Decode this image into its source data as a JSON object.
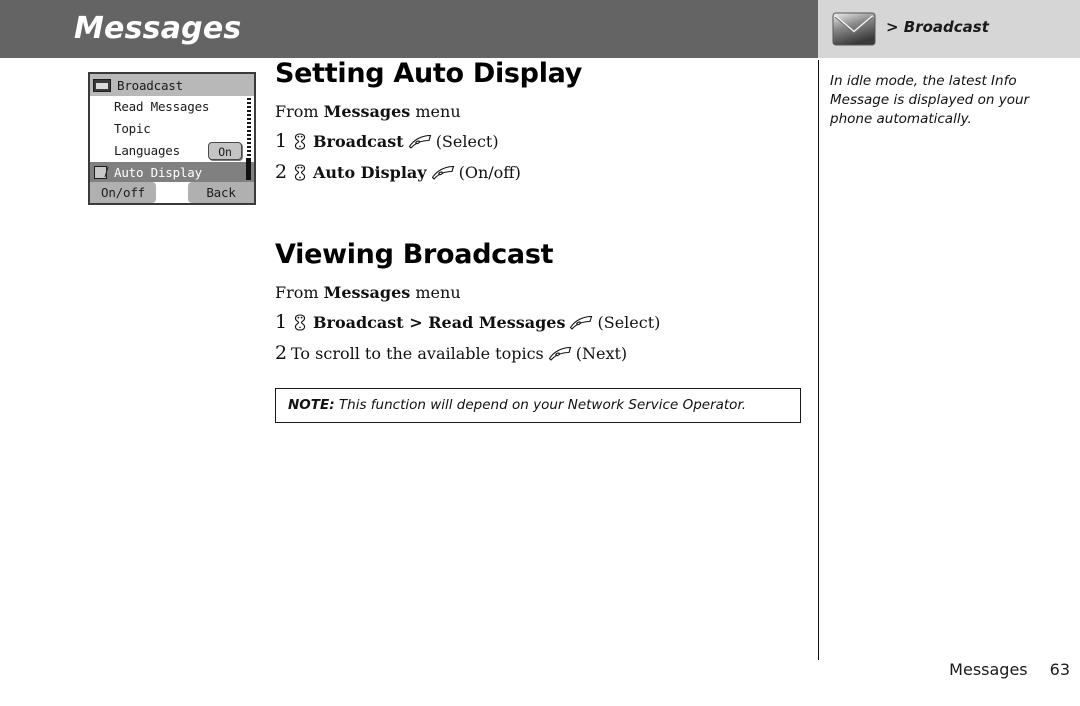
{
  "header": {
    "title": "Messages",
    "tab_label": "> Broadcast",
    "tab_icon": "envelope-icon",
    "bar_color": "#646464",
    "tab_bg_color": "#d6d6d6"
  },
  "phone_mockup": {
    "title": "Broadcast",
    "title_icon": "broadcast-icon",
    "items": [
      {
        "label": "Read Messages",
        "selected": false,
        "checked": false,
        "badge": null
      },
      {
        "label": "Topic",
        "selected": false,
        "checked": false,
        "badge": null
      },
      {
        "label": "Languages",
        "selected": false,
        "checked": false,
        "badge": "On"
      },
      {
        "label": "Auto Display",
        "selected": true,
        "checked": true,
        "badge": null
      }
    ],
    "softkey_left": "On/off",
    "softkey_right": "Back"
  },
  "sections": [
    {
      "title": "Setting Auto Display",
      "from_prefix": "From ",
      "from_bold": "Messages",
      "from_suffix": " menu",
      "steps": [
        {
          "num": "1",
          "nav_icon": "navigation-key-icon",
          "label": "Broadcast",
          "soft_icon": "softkey-icon",
          "action": "(Select)"
        },
        {
          "num": "2",
          "nav_icon": "navigation-key-icon",
          "label": "Auto Display",
          "soft_icon": "softkey-icon",
          "action": "(On/off)"
        }
      ]
    },
    {
      "title": "Viewing Broadcast",
      "from_prefix": "From ",
      "from_bold": "Messages",
      "from_suffix": " menu",
      "steps": [
        {
          "num": "1",
          "nav_icon": "navigation-key-icon",
          "label": "Broadcast > Read Messages",
          "soft_icon": "softkey-icon",
          "action": "(Select)"
        },
        {
          "num": "2",
          "nav_icon": null,
          "label": "To scroll to the available topics",
          "soft_icon": "softkey-icon",
          "action": "(Next)"
        }
      ]
    }
  ],
  "note": {
    "label": "NOTE:",
    "text": " This function will depend on your Network Service Operator."
  },
  "sidenote": {
    "text": "In idle mode, the latest Info Message is displayed on your phone automatically."
  },
  "footer": {
    "chapter": "Messages",
    "page": "63"
  }
}
